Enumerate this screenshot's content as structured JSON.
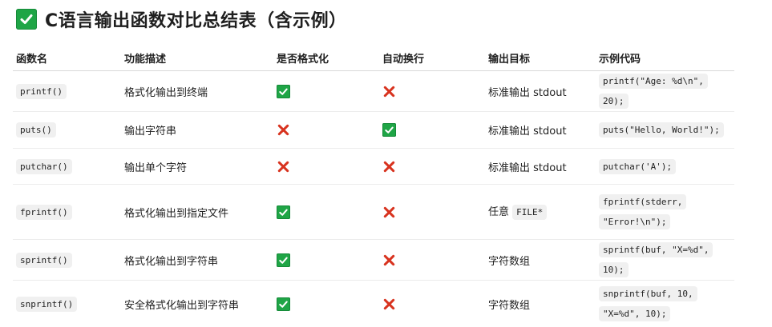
{
  "title": "C语言输出函数对比总结表（含示例）",
  "headers": [
    "函数名",
    "功能描述",
    "是否格式化",
    "自动换行",
    "输出目标",
    "示例代码"
  ],
  "rows": [
    {
      "func": "printf()",
      "desc": "格式化输出到终端",
      "formatted": true,
      "newline": false,
      "target_text": "标准输出 stdout",
      "target_code": "",
      "example": "printf(\"Age: %d\\n\", 20);"
    },
    {
      "func": "puts()",
      "desc": "输出字符串",
      "formatted": false,
      "newline": true,
      "target_text": "标准输出 stdout",
      "target_code": "",
      "example": "puts(\"Hello, World!\");"
    },
    {
      "func": "putchar()",
      "desc": "输出单个字符",
      "formatted": false,
      "newline": false,
      "target_text": "标准输出 stdout",
      "target_code": "",
      "example": "putchar('A');"
    },
    {
      "func": "fprintf()",
      "desc": "格式化输出到指定文件",
      "formatted": true,
      "newline": false,
      "target_text": "任意",
      "target_code": "FILE*",
      "example": "fprintf(stderr, \"Error!\\n\");"
    },
    {
      "func": "sprintf()",
      "desc": "格式化输出到字符串",
      "formatted": true,
      "newline": false,
      "target_text": "字符数组",
      "target_code": "",
      "example": "sprintf(buf, \"X=%d\", 10);"
    },
    {
      "func": "snprintf()",
      "desc": "安全格式化输出到字符串",
      "formatted": true,
      "newline": false,
      "target_text": "字符数组",
      "target_code": "",
      "example": "snprintf(buf, 10, \"X=%d\", 10);"
    }
  ],
  "icons": {
    "yes": "check-mark-icon",
    "no": "cross-mark-icon"
  },
  "colors": {
    "check_bg": "#1fa546",
    "cross": "#d8331f"
  }
}
